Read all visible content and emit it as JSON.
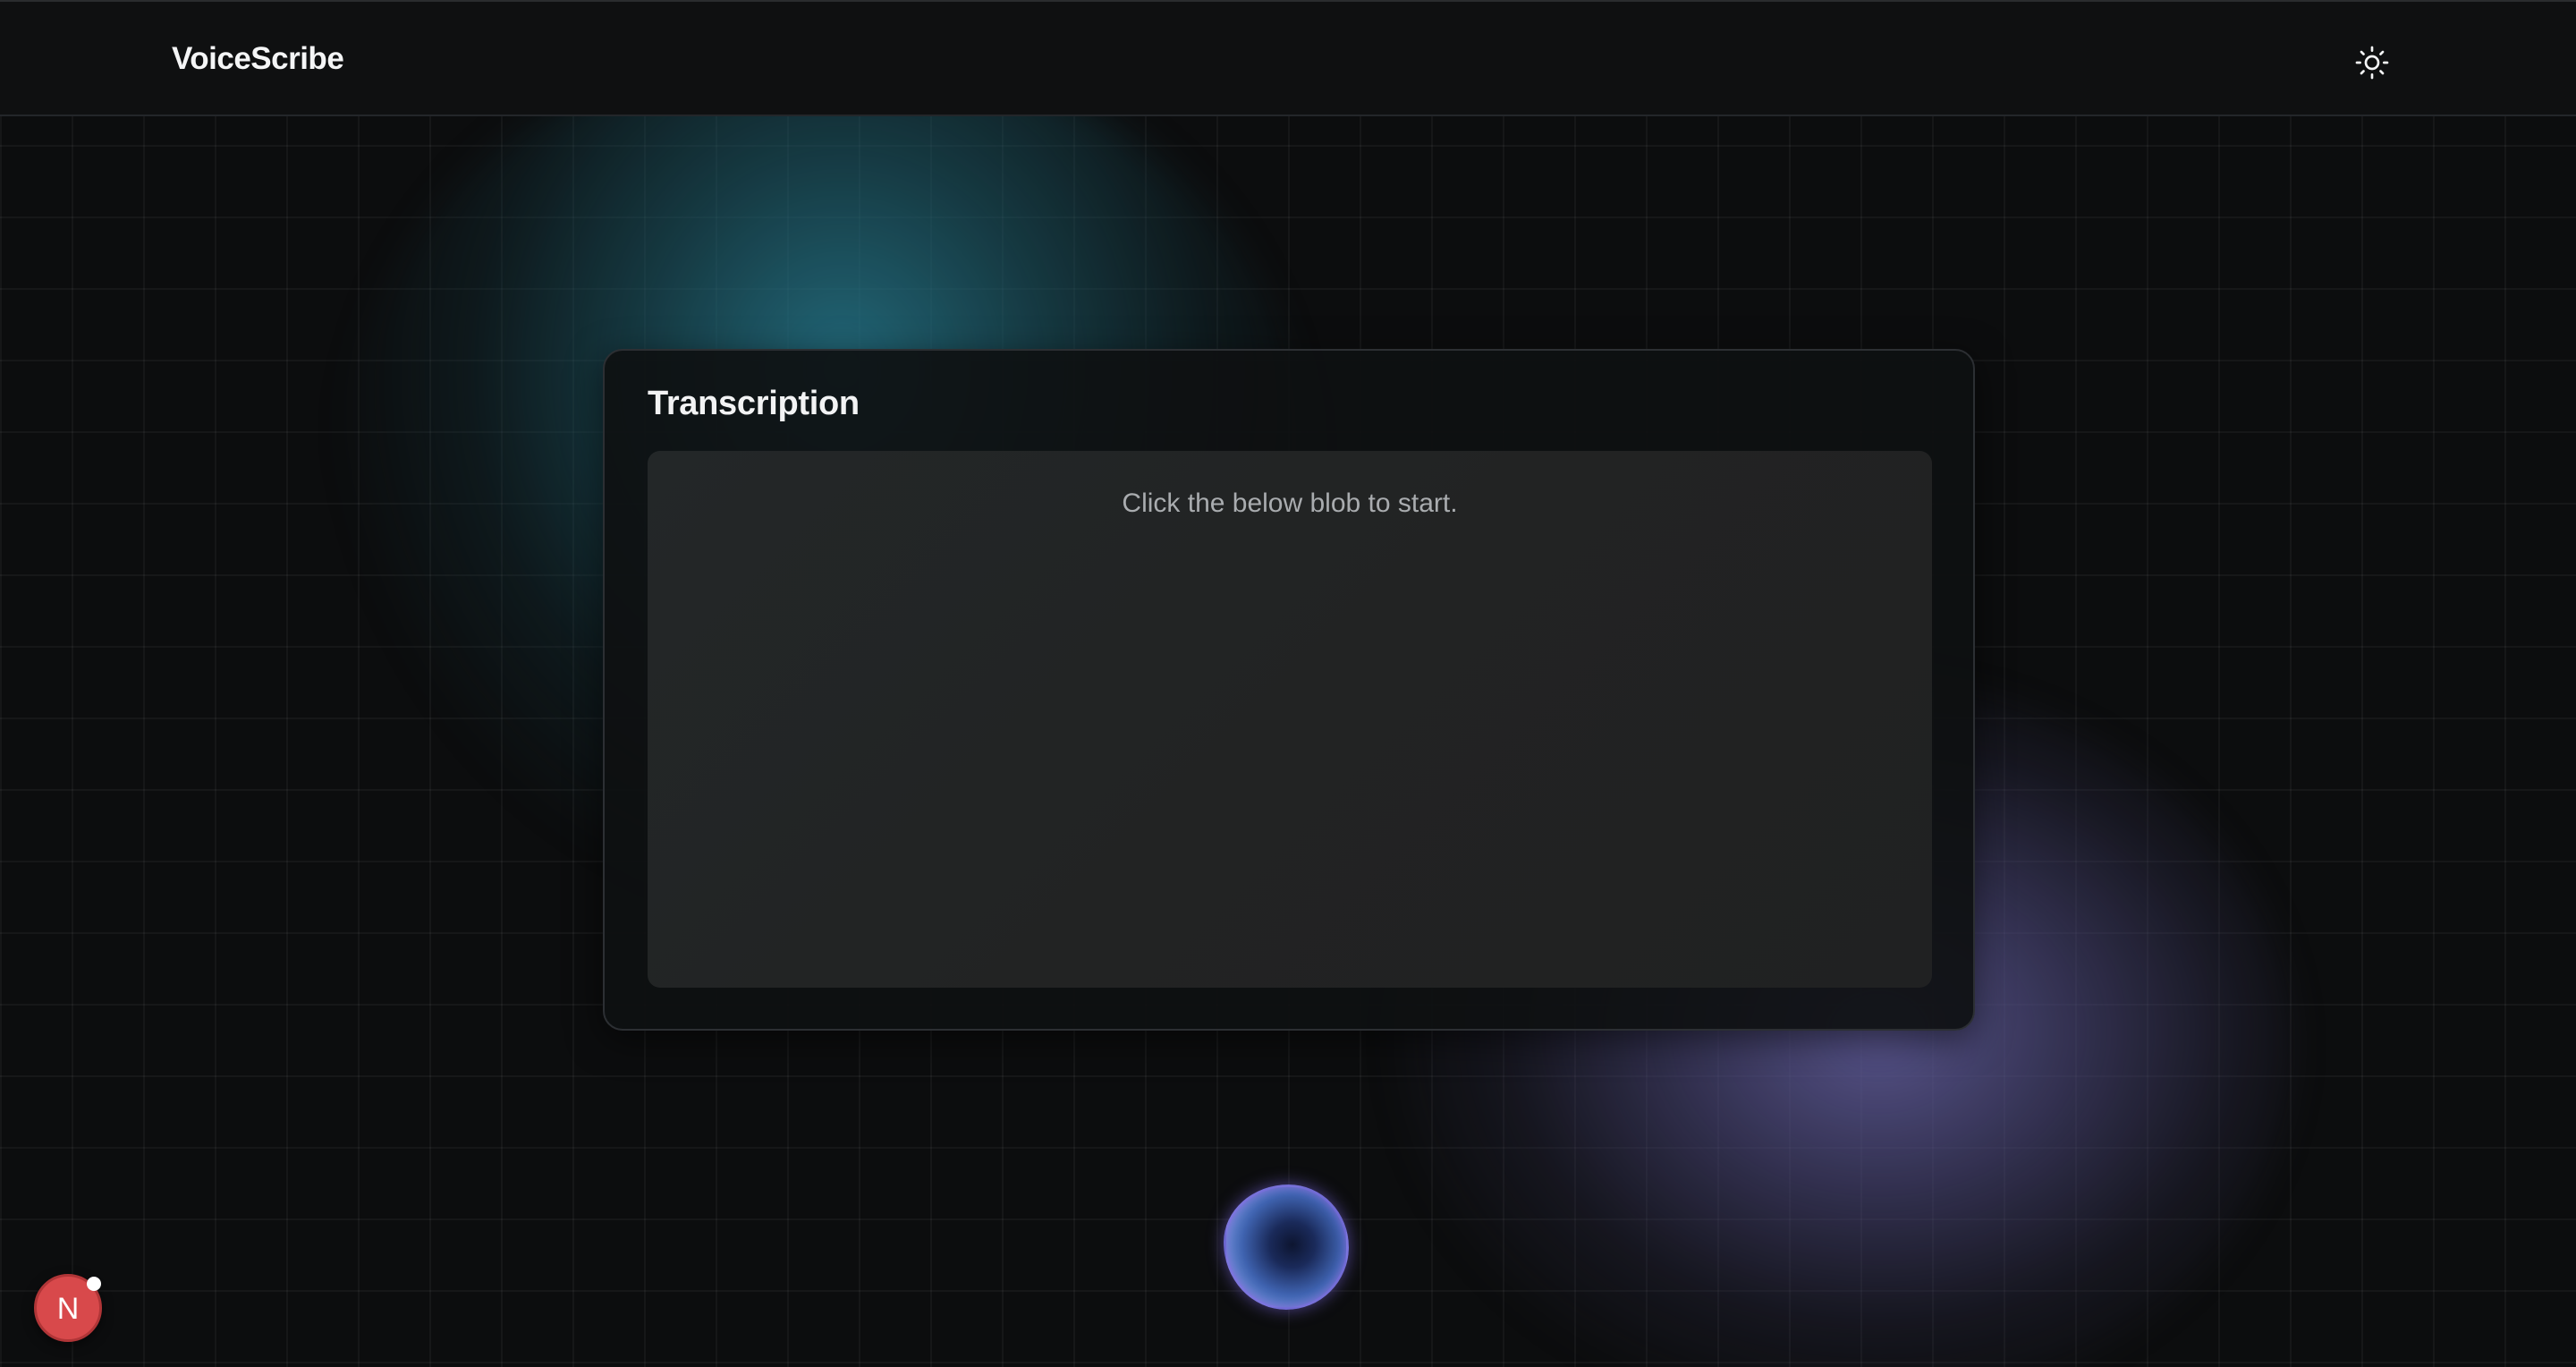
{
  "header": {
    "app_title": "VoiceScribe",
    "theme_toggle_icon": "sun-icon"
  },
  "transcription_card": {
    "title": "Transcription",
    "placeholder": "Click the below blob to start."
  },
  "record_blob": {
    "icon": "voice-blob"
  },
  "dev_badge": {
    "letter": "N",
    "color": "#d8494b"
  },
  "colors": {
    "background": "#0c0d0e",
    "teal_glow": "#26788c",
    "purple_glow": "#6460a0",
    "blob_blue": "#3f63b0"
  }
}
